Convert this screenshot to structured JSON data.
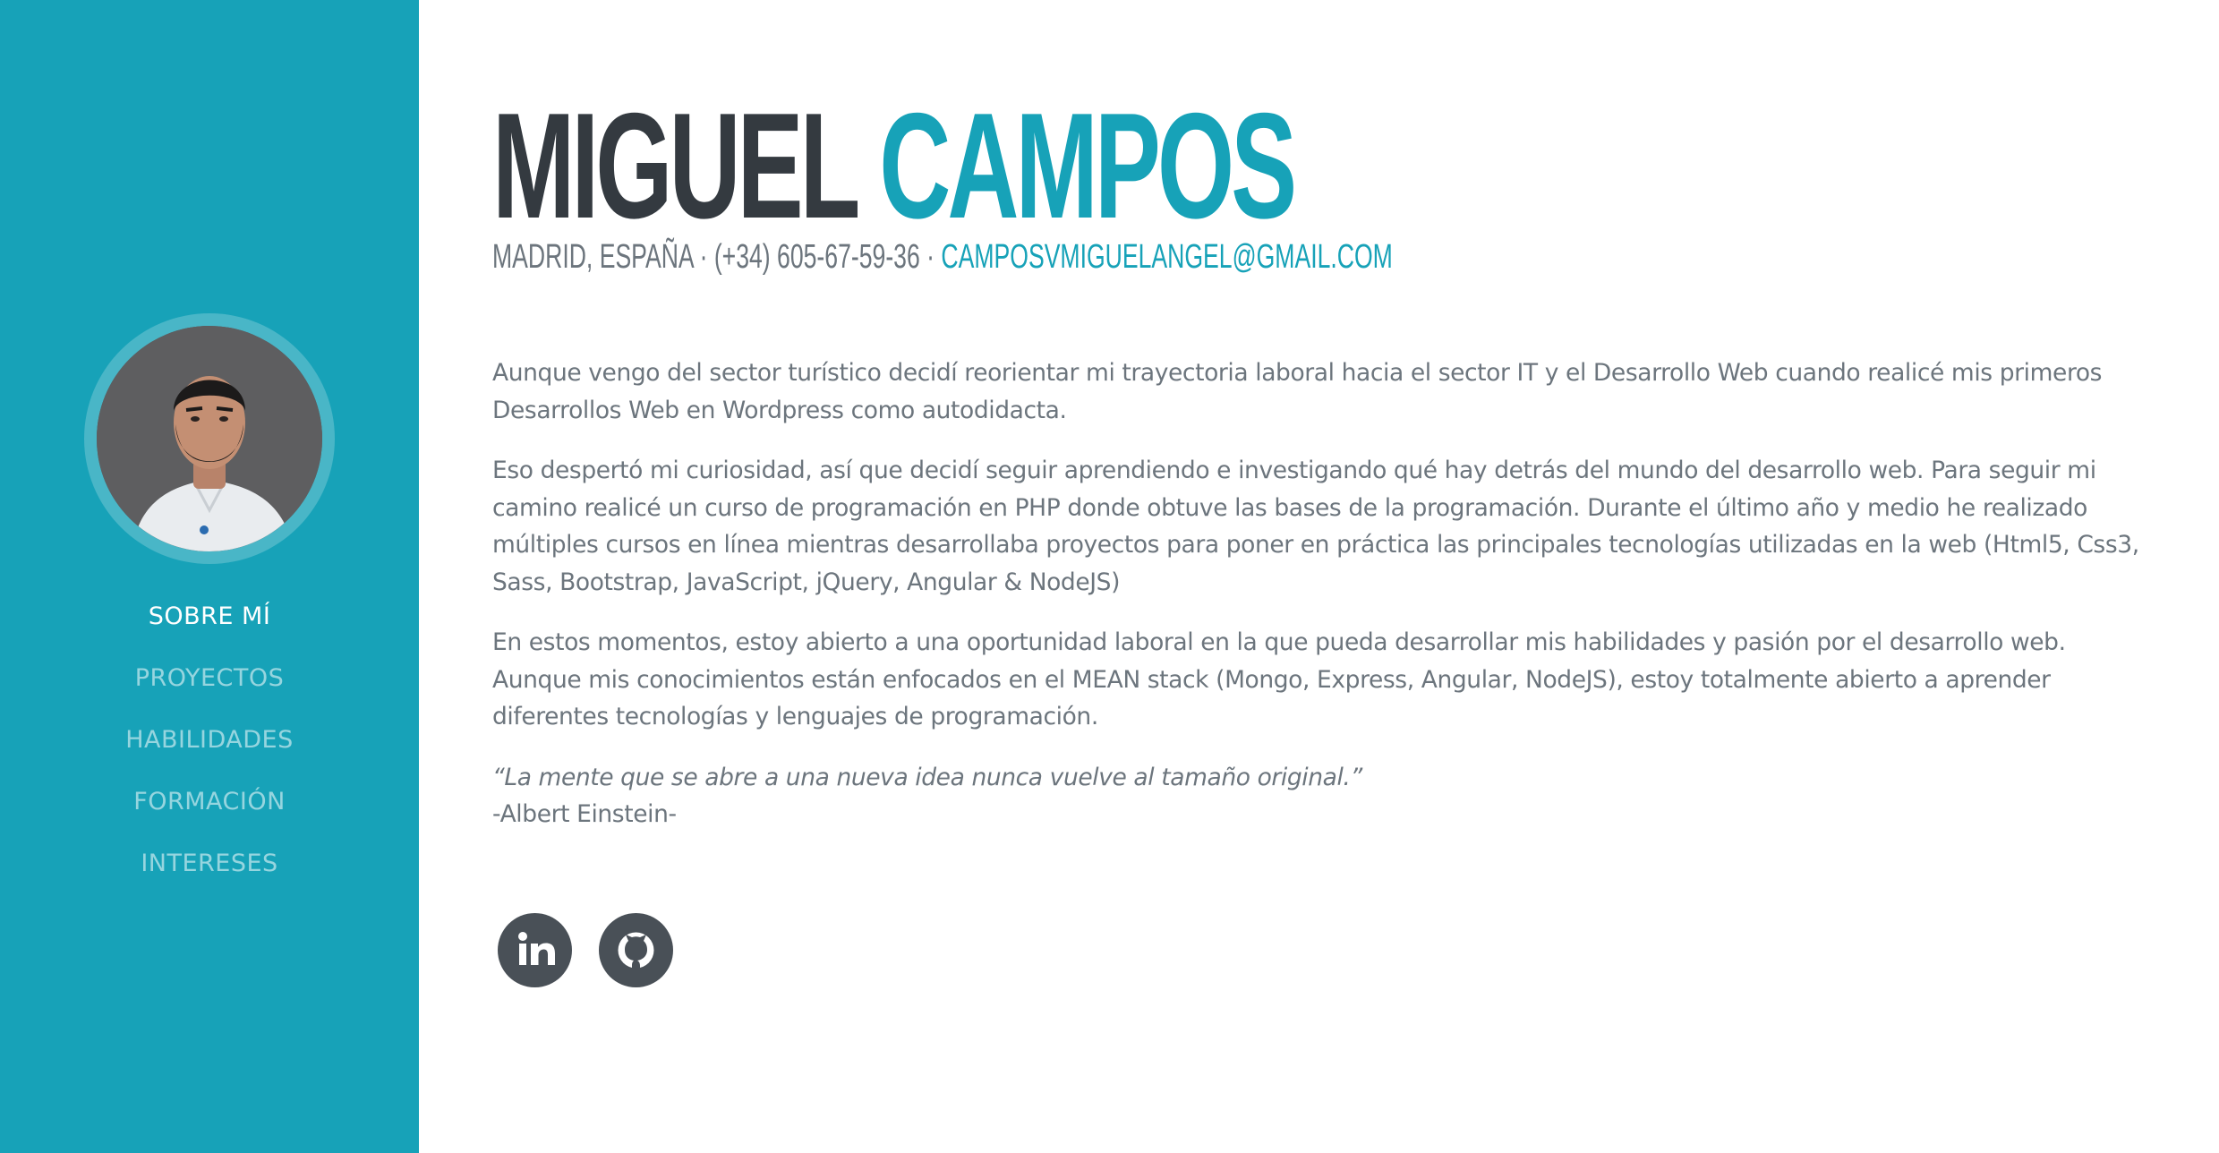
{
  "profile": {
    "first_name": "MIGUEL",
    "last_name": "CAMPOS",
    "location_phone": "MADRID, ESPAÑA · (+34) 605-67-59-36 · ",
    "email": "CAMPOSVMIGUELANGEL@GMAIL.COM"
  },
  "nav": {
    "items": [
      {
        "label": "SOBRE MÍ",
        "active": true
      },
      {
        "label": "PROYECTOS",
        "active": false
      },
      {
        "label": "HABILIDADES",
        "active": false
      },
      {
        "label": "FORMACIÓN",
        "active": false
      },
      {
        "label": "INTERESES",
        "active": false
      }
    ]
  },
  "about": {
    "p1": "Aunque vengo del sector turístico decidí reorientar mi trayectoria laboral hacia el sector IT y el Desarrollo Web cuando realicé mis primeros Desarrollos Web en Wordpress como autodidacta.",
    "p2": "Eso despertó mi curiosidad, así que decidí seguir aprendiendo e investigando qué hay detrás del mundo del desarrollo web. Para seguir mi camino realicé un curso de programación en PHP donde obtuve las bases de la programación. Durante el último año y medio he realizado múltiples cursos en línea mientras desarrollaba proyectos para poner en práctica las principales tecnologías utilizadas en la web (Html5, Css3, Sass, Bootstrap, JavaScript, jQuery, Angular & NodeJS)",
    "p3": "En estos momentos, estoy abierto a una oportunidad laboral en la que pueda desarrollar mis habilidades y pasión por el desarrollo web. Aunque mis conocimientos están enfocados en el MEAN stack (Mongo, Express, Angular, NodeJS), estoy totalmente abierto a aprender diferentes tecnologías y lenguajes de programación.",
    "quote": "“La mente que se abre a una nueva idea nunca vuelve al tamaño original.”",
    "quote_author": "-Albert Einstein-"
  },
  "social": {
    "items": [
      {
        "name": "linkedin-icon"
      },
      {
        "name": "github-icon"
      }
    ]
  },
  "colors": {
    "primary": "#17a2b8",
    "dark": "#343a40",
    "text": "#6c757d",
    "social_bg": "#495057"
  }
}
